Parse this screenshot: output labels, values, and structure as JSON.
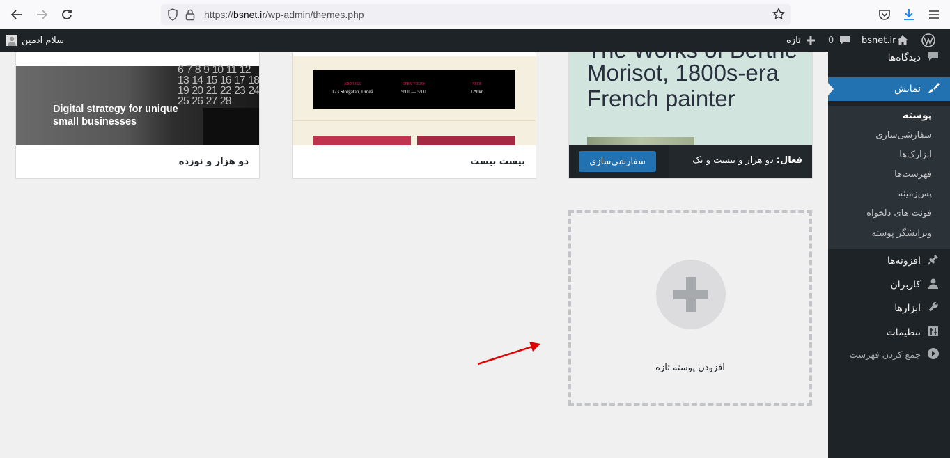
{
  "browser": {
    "url_prefix": "https://",
    "url_host": "bsnet.ir",
    "url_path": "/wp-admin/themes.php"
  },
  "adminbar": {
    "site_name": "bsnet.ir",
    "comments_count": "0",
    "new_label": "تازه",
    "greeting": "سلام ادمین"
  },
  "sidebar": {
    "comments": "دیدگاه‌ها",
    "appearance": "نمایش",
    "submenu": [
      "پوسته",
      "سفارشی‌سازی",
      "ابزارک‌ها",
      "فهرست‌ها",
      "پس‌زمینه",
      "فونت های دلخواه",
      "ویرایشگر پوسته"
    ],
    "plugins": "افزونه‌ها",
    "users": "کاربران",
    "tools": "ابزارها",
    "settings": "تنظیمات",
    "collapse": "جمع کردن فهرست"
  },
  "themes": {
    "active_prefix": "فعال:",
    "active_name": "دو هزار و بیست و یک",
    "customize_button": "سفارشی‌سازی",
    "active_preview_text": "Morisot, 1800s-era French painter",
    "active_preview_top": "The Works of Berthe",
    "twenty_twenty_name": "بیست بیست",
    "tt_address_label": "ADDRESS",
    "tt_address": "123 Storgatan, Umeå",
    "tt_open_label": "OPEN TODAY",
    "tt_open": "9:00 — 5:00",
    "tt_price_label": "PRICE",
    "tt_price": "129 kr",
    "twenty_nineteen_name": "دو هزار و نوزده",
    "tn_preview_text": "Digital strategy for unique small businesses",
    "tn_calendar": "6 7 8 9 10 11 12 13 14 15 16 17 18 19 20 21 22 23 24 25 26 27 28"
  },
  "add_new": {
    "label": "افزودن پوسته تازه"
  },
  "colors": {
    "accent": "#2271b1",
    "adminbar": "#1d2327",
    "arrow": "#e00000"
  }
}
